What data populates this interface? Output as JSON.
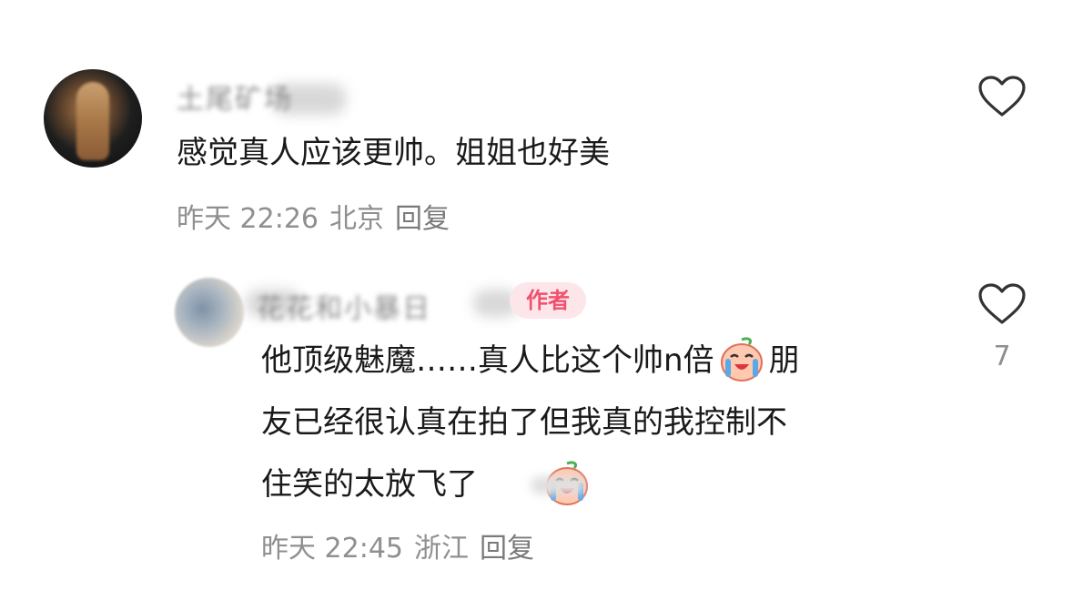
{
  "comments": [
    {
      "username": "土尾矿场",
      "text": "感觉真人应该更帅。姐姐也好美",
      "time": "昨天 22:26",
      "location": "北京",
      "reply_label": "回复",
      "likes": ""
    },
    {
      "username": "花花和小暴日",
      "badge": "作者",
      "text_lines": [
        "他顶级魅魔……真人比这个帅n倍",
        "友已经很认真在拍了但我真的我控制不",
        "住笑的太放飞了"
      ],
      "line1_tail": "朋",
      "emoji": "crying-laughing-peach-icon",
      "time": "昨天 22:45",
      "location": "浙江",
      "reply_label": "回复",
      "likes": "7"
    }
  ],
  "colors": {
    "text": "#1a1a1a",
    "meta": "#8f8f8f",
    "badge_bg": "#fde6ea",
    "badge_text": "#f0506e"
  }
}
